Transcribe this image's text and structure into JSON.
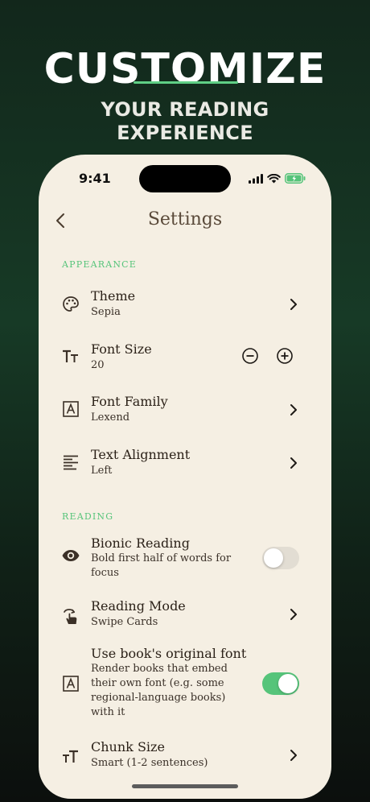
{
  "hero": {
    "title": "CUSTOMIZE",
    "subtitle_line1": "YOUR READING",
    "subtitle_line2": "EXPERIENCE"
  },
  "status_bar": {
    "time": "9:41"
  },
  "nav": {
    "title": "Settings"
  },
  "sections": {
    "appearance": "APPEARANCE",
    "reading": "READING"
  },
  "appearance_rows": {
    "theme": {
      "title": "Theme",
      "value": "Sepia",
      "icon": "palette-icon"
    },
    "font_size": {
      "title": "Font Size",
      "value": "20",
      "icon": "text-size-icon"
    },
    "font_family": {
      "title": "Font Family",
      "value": "Lexend",
      "icon": "font-icon"
    },
    "text_alignment": {
      "title": "Text Alignment",
      "value": "Left",
      "icon": "align-left-icon"
    }
  },
  "reading_rows": {
    "bionic": {
      "title": "Bionic Reading",
      "value": "Bold first half of words for focus",
      "icon": "eye-icon",
      "enabled": false
    },
    "mode": {
      "title": "Reading Mode",
      "value": "Swipe Cards",
      "icon": "swipe-icon"
    },
    "original_font": {
      "title": "Use book's original font",
      "value": "Render books that embed their own font (e.g. some regional-language books) with it",
      "icon": "font-icon",
      "enabled": true
    },
    "chunk": {
      "title": "Chunk Size",
      "value": "Smart (1-2 sentences)",
      "icon": "text-size-icon"
    }
  },
  "colors": {
    "accent": "#56c47a",
    "page_background": "#f5efe3",
    "text": "#2b2118"
  }
}
